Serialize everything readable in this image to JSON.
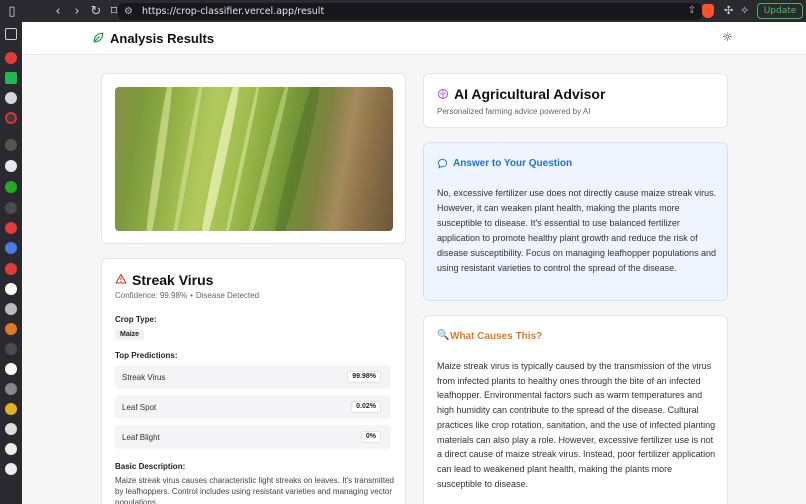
{
  "browser": {
    "url": "https://crop-classifier.vercel.app/result",
    "update_label": "Update"
  },
  "header": {
    "title": "Analysis Results"
  },
  "diagnosis": {
    "disease_name": "Streak Virus",
    "confidence_text": "Confidence: 99.98%",
    "status_text": "Disease Detected",
    "crop_type_label": "Crop Type:",
    "crop_type_value": "Maize",
    "top_predictions_label": "Top Predictions:",
    "predictions": [
      {
        "name": "Streak Virus",
        "value": "99.98%"
      },
      {
        "name": "Leaf Spot",
        "value": "0.02%"
      },
      {
        "name": "Leaf Blight",
        "value": "0%"
      }
    ],
    "basic_description_label": "Basic Description:",
    "basic_description": "Maize streak virus causes characteristic light streaks on leaves. It's transmitted by leafhoppers. Control includes using resistant varieties and managing vector populations."
  },
  "advisor": {
    "title": "AI Agricultural Advisor",
    "subtitle": "Personalized farming advice powered by AI"
  },
  "answer": {
    "title": "Answer to Your Question",
    "text": "No, excessive fertilizer use does not directly cause maize streak virus. However, it can weaken plant health, making the plants more susceptible to disease. It's essential to use balanced fertilizer application to promote healthy plant growth and reduce the risk of disease susceptibility. Focus on managing leafhopper populations and using resistant varieties to control the spread of the disease."
  },
  "causes": {
    "title": "What Causes This?",
    "text": "Maize streak virus is typically caused by the transmission of the virus from infected plants to healthy ones through the bite of an infected leafhopper. Environmental factors such as warm temperatures and high humidity can contribute to the spread of the disease. Cultural practices like crop rotation, sanitation, and the use of infected planting materials can also play a role. However, excessive fertilizer use is not a direct cause of maize streak virus. Instead, poor fertilizer application can lead to weakened plant health, making the plants more susceptible to disease."
  },
  "colors": {
    "accent_blue": "#1f6fe0",
    "accent_orange": "#e07a1f",
    "warning_red": "#d93025",
    "advisor_purple": "#9b51e0",
    "leaf_green": "#2e9e4f"
  },
  "icons": [
    "leaf-icon",
    "sun-icon",
    "warning-triangle-icon",
    "brain-icon",
    "chat-bubble-icon",
    "magnifier-icon"
  ]
}
